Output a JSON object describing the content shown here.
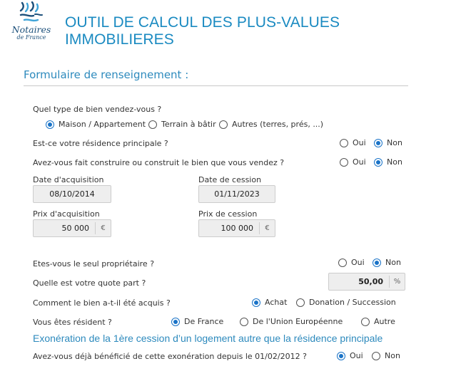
{
  "header": {
    "logo_line1": "Notaires",
    "logo_line2": "de France",
    "title": "OUTIL DE CALCUL DES PLUS-VALUES IMMOBILIERES"
  },
  "form": {
    "section_title": "Formulaire de renseignement :",
    "property_type": {
      "question": "Quel type de bien vendez-vous ?",
      "options": [
        "Maison / Appartement",
        "Terrain à bâtir",
        "Autres (terres, prés, ...)"
      ],
      "selected": "Maison / Appartement"
    },
    "main_residence": {
      "question": "Est-ce votre résidence principale ?",
      "options": [
        "Oui",
        "Non"
      ],
      "selected": "Non"
    },
    "self_built": {
      "question": "Avez-vous fait construire ou construit le bien que vous vendez ?",
      "options": [
        "Oui",
        "Non"
      ],
      "selected": "Non"
    },
    "acquisition_date": {
      "label": "Date d'acquisition",
      "value": "08/10/2014"
    },
    "sale_date": {
      "label": "Date de cession",
      "value": "01/11/2023"
    },
    "acquisition_price": {
      "label": "Prix d'acquisition",
      "value": "50 000",
      "unit": "€"
    },
    "sale_price": {
      "label": "Prix de cession",
      "value": "100 000",
      "unit": "€"
    },
    "sole_owner": {
      "question": "Etes-vous le seul propriétaire ?",
      "options": [
        "Oui",
        "Non"
      ],
      "selected": "Non"
    },
    "share": {
      "question": "Quelle est votre quote part ?",
      "value": "50,00",
      "unit": "%"
    },
    "acquired_how": {
      "question": "Comment le bien a-t-il été acquis ?",
      "options": [
        "Achat",
        "Donation / Succession"
      ],
      "selected": "Achat"
    },
    "residency": {
      "question": "Vous êtes résident ?",
      "options": [
        "De France",
        "De l'Union Européenne",
        "Autre"
      ],
      "selected": "De France"
    },
    "exemption_heading": "Exonération de la 1ère cession d’un logement autre que la résidence principale",
    "exemption_benefited": {
      "question": "Avez-vous déjà bénéficié de cette exonération depuis le 01/02/2012 ?",
      "options": [
        "Oui",
        "Non"
      ],
      "selected": "Oui"
    }
  },
  "colors": {
    "title_blue": "#1a8ac1",
    "radio_selected": "#1a73c7",
    "field_bg": "#eeeeee"
  }
}
